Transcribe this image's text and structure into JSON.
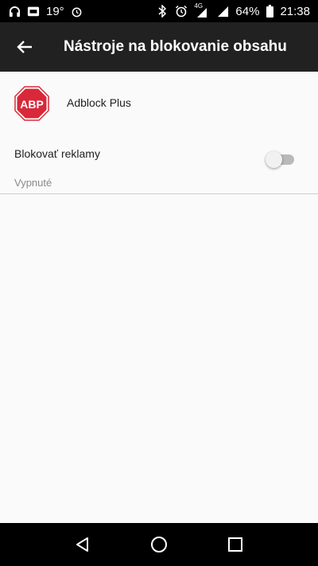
{
  "status_bar": {
    "temperature": "19°",
    "battery": "64%",
    "time": "21:38",
    "network": "4G",
    "icons_left": [
      "headphones-icon",
      "weather-app-icon",
      "alarm-icon"
    ],
    "icons_right": [
      "bluetooth-icon",
      "alarm-icon",
      "signal-icon",
      "battery-icon"
    ]
  },
  "app_bar": {
    "title": "Nástroje na blokovanie obsahu",
    "back_icon": "arrow-back-icon"
  },
  "provider": {
    "logo_text": "ABP",
    "name": "Adblock Plus",
    "logo_color": "#d8283a"
  },
  "block_ads": {
    "label": "Blokovať reklamy",
    "status": "Vypnuté",
    "enabled": false
  },
  "nav_bar": {
    "buttons": [
      "back-triangle-icon",
      "home-circle-icon",
      "recents-square-icon"
    ]
  }
}
